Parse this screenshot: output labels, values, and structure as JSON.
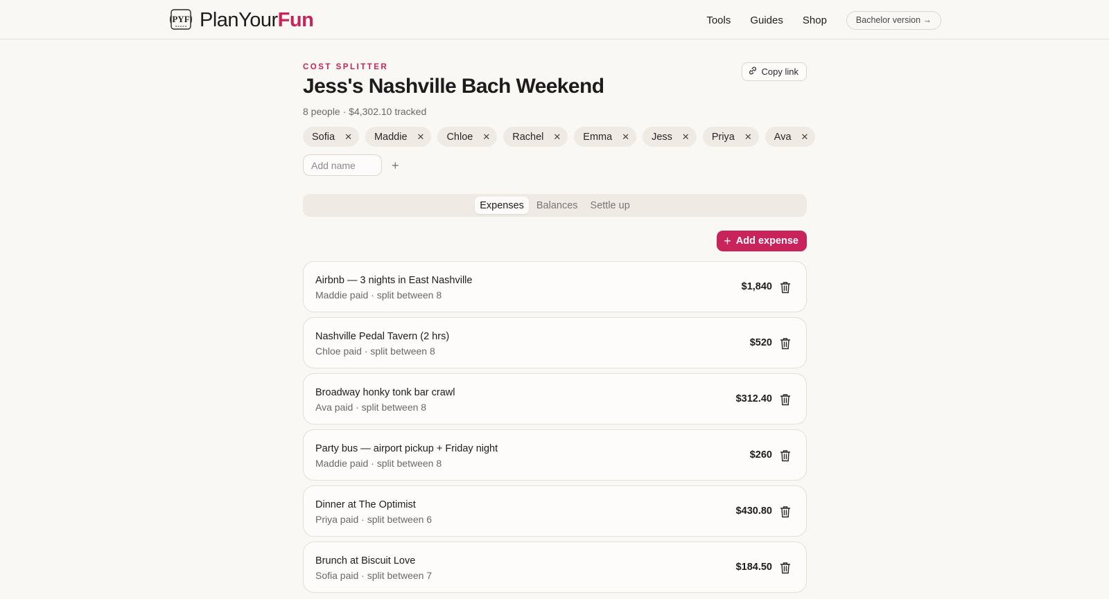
{
  "header": {
    "logo": {
      "plan": "PlanYour",
      "fun": "Fun"
    },
    "nav": [
      "Tools",
      "Guides",
      "Shop"
    ],
    "bachelor_link": "Bachelor version →"
  },
  "page": {
    "eyebrow": "COST SPLITTER",
    "title": "Jess's Nashville Bach Weekend",
    "subtitle": "8 people · $4,302.10 tracked",
    "copy_link": "Copy link"
  },
  "people": [
    "Sofia",
    "Maddie",
    "Chloe",
    "Rachel",
    "Emma",
    "Jess",
    "Priya",
    "Ava"
  ],
  "add_name": {
    "placeholder": "Add name",
    "plus": "+"
  },
  "tabs": [
    {
      "label": "Expenses",
      "active": true
    },
    {
      "label": "Balances",
      "active": false
    },
    {
      "label": "Settle up",
      "active": false
    }
  ],
  "add_expense_label": "Add expense",
  "expenses": [
    {
      "name": "Airbnb — 3 nights in East Nashville",
      "meta": "Maddie paid · split between 8",
      "amount": "$1,840"
    },
    {
      "name": "Nashville Pedal Tavern (2 hrs)",
      "meta": "Chloe paid · split between 8",
      "amount": "$520"
    },
    {
      "name": "Broadway honky tonk bar crawl",
      "meta": "Ava paid · split between 8",
      "amount": "$312.40"
    },
    {
      "name": "Party bus — airport pickup + Friday night",
      "meta": "Maddie paid · split between 8",
      "amount": "$260"
    },
    {
      "name": "Dinner at The Optimist",
      "meta": "Priya paid · split between 6",
      "amount": "$430.80"
    },
    {
      "name": "Brunch at Biscuit Love",
      "meta": "Sofia paid · split between 7",
      "amount": "$184.50"
    }
  ],
  "colors": {
    "accent": "#c8235a",
    "background": "#faf8f4",
    "card": "#fdfcfa"
  }
}
